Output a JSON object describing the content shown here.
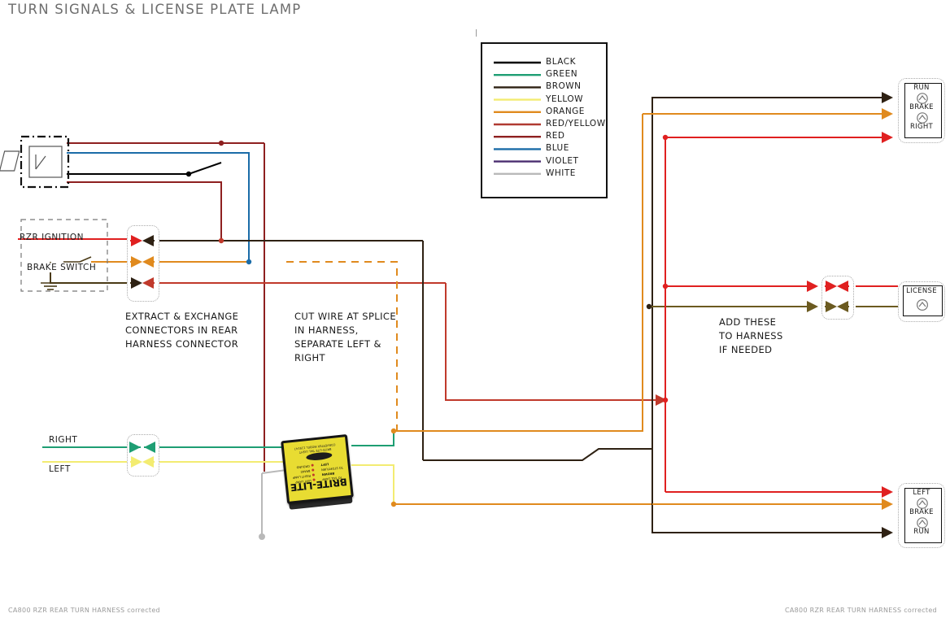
{
  "page": {
    "title": "TURN SIGNALS & LICENSE PLATE LAMP",
    "footer_left": "CA800 RZR REAR TURN HARNESS corrected",
    "footer_right": "CA800 RZR REAR TURN HARNESS corrected",
    "background": "#ffffff"
  },
  "legend": {
    "title": "",
    "items": [
      {
        "label": "BLACK",
        "color": "#000000"
      },
      {
        "label": "GREEN",
        "color": "#1e9e73"
      },
      {
        "label": "BROWN",
        "color": "#2e2113"
      },
      {
        "label": "YELLOW",
        "color": "#f3ec71"
      },
      {
        "label": "ORANGE",
        "color": "#e08a1e"
      },
      {
        "label": "RED/YELLOW",
        "color": "#b03a32"
      },
      {
        "label": "RED",
        "color": "#8e2020"
      },
      {
        "label": "BLUE",
        "color": "#1b6ca8"
      },
      {
        "label": "VIOLET",
        "color": "#4b2e70"
      },
      {
        "label": "WHITE",
        "color": "#b9b9b9"
      }
    ]
  },
  "labels": {
    "rzr_ignition": "RZR IGNITION",
    "brake_switch": "BRAKE SWITCH",
    "right": "RIGHT",
    "left": "LEFT"
  },
  "notes": {
    "extract": "EXTRACT & EXCHANGE\nCONNECTORS IN REAR\nHARNESS CONNECTOR",
    "cut": "CUT WIRE AT SPLICE\nIN HARNESS,\nSEPARATE LEFT &\nRIGHT",
    "add": "ADD THESE\nTO HARNESS\nIF NEEDED"
  },
  "lamps": {
    "top_right": {
      "lines": [
        "RUN",
        "BRAKE",
        "RIGHT"
      ]
    },
    "license": {
      "lines": [
        "LICENSE"
      ]
    },
    "bottom_right": {
      "lines": [
        "LEFT",
        "BRAKE",
        "RUN"
      ]
    }
  },
  "module": {
    "brand": "BRITE-LITE",
    "sub": "eTrailer",
    "top_text": "BRITE-LITE TAIL LIGHT\nCONVERTER  MODEL 119147",
    "led_labels": [
      "LEFT LAMP",
      "RIGHT LAMP",
      "BRAKE",
      "GROUND"
    ],
    "right_labels": [
      "TO TAIL LAMP",
      "BROWN",
      "TO STOP/TURN",
      "LEFT"
    ]
  },
  "connectors": {
    "rear_harness": {
      "rows": [
        {
          "left_color": "#c0392b",
          "right_color": "#2e2113"
        },
        {
          "left_color": "#e08a1e",
          "right_color": "#e08a1e"
        },
        {
          "left_color": "#2e2113",
          "right_color": "#c0392b"
        }
      ]
    },
    "turn_input": {
      "rows": [
        {
          "left_color": "#1e9e73",
          "right_color": "#1e9e73"
        },
        {
          "left_color": "#f3ec71",
          "right_color": "#f3ec71"
        }
      ]
    },
    "license_add": {
      "rows": [
        {
          "left_color": "#e02020",
          "right_color": "#e02020"
        },
        {
          "left_color": "#6b5a20",
          "right_color": "#6b5a20"
        }
      ]
    }
  },
  "chart_data": {
    "type": "diagram",
    "title": "TURN SIGNALS & LICENSE PLATE LAMP"
  }
}
